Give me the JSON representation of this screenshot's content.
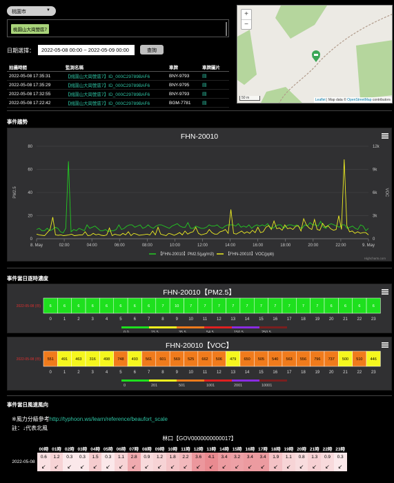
{
  "header": {
    "city": "桃園市",
    "site_tag": "桃園山大崗營區7",
    "date_label": "日期選擇：",
    "date_range": "2022-05-08 00:00 ~ 2022-05-09 00:00",
    "query_button": "查詢"
  },
  "events": {
    "columns": [
      "拍攝時間",
      "監測名稱",
      "車牌",
      "車牌圖片"
    ],
    "rows": [
      {
        "time": "2022-05-08 17:35:31",
        "site": "【桃園山大崗營區7】ID_000C29789BAF6",
        "plate": "BNY-9793"
      },
      {
        "time": "2022-05-08 17:35:29",
        "site": "【桃園山大崗營區7】ID_000C29789BAF6",
        "plate": "BNY-9795"
      },
      {
        "time": "2022-05-08 17:32:55",
        "site": "【桃園山大崗營區7】ID_000C29789BAF6",
        "plate": "BNY-9793"
      },
      {
        "time": "2022-05-08 17:22:42",
        "site": "【桃園山大崗營區7】ID_000C29789BAF6",
        "plate": "BGM-7781"
      }
    ]
  },
  "map": {
    "zoom_in": "+",
    "zoom_out": "−",
    "scale": "50 m",
    "attribution_leaflet": "Leaflet",
    "attribution_text": " | Map data © ",
    "attribution_osm": "OpenStreetMap",
    "attribution_tail": " contributors",
    "colors": {
      "park": "#b5d69d",
      "land": "#eceae4",
      "marker": "#3aa655"
    }
  },
  "trend": {
    "section_title": "事件趨勢",
    "chart_title": "FHN-20010",
    "credit": "Highcharts.com"
  },
  "pm_section": {
    "title": "事件當日逐時濃度"
  },
  "pm_heat": {
    "title": "FHN-20010【PM2.5】",
    "date_label": "2022-05-08 (日)",
    "scale_labels": [
      "0.0",
      "15.5",
      "35.5",
      "54.5",
      "150.5",
      "250.5"
    ],
    "values": [
      "6",
      "6",
      "6",
      "6",
      "6",
      "6",
      "6",
      "6",
      "7",
      "10",
      "7",
      "7",
      "7",
      "7",
      "7",
      "7",
      "7",
      "7",
      "7",
      "7",
      "6",
      "6",
      "6",
      "6"
    ],
    "colors": {
      "cell": "#1ee01e",
      "date": "#d02020"
    }
  },
  "voc_heat": {
    "title": "FHN-20010【VOC】",
    "date_label": "2022-05-08 (日)",
    "scale_labels": [
      "0",
      "201",
      "501",
      "1001",
      "2001",
      "10001"
    ],
    "values": [
      "551",
      "491",
      "463",
      "316",
      "498",
      "748",
      "493",
      "561",
      "601",
      "569",
      "525",
      "662",
      "506",
      "479",
      "650",
      "505",
      "540",
      "563",
      "556",
      "796",
      "737",
      "500",
      "510",
      "446"
    ],
    "cell_colors": [
      "#f07b1c",
      "#f5f71e",
      "#f5f71e",
      "#f5f71e",
      "#f5f71e",
      "#f07b1c",
      "#f5f71e",
      "#f07b1c",
      "#f07b1c",
      "#f07b1c",
      "#f07b1c",
      "#f07b1c",
      "#f07b1c",
      "#f5f71e",
      "#f07b1c",
      "#f07b1c",
      "#f07b1c",
      "#f07b1c",
      "#f07b1c",
      "#f07b1c",
      "#f07b1c",
      "#f5f71e",
      "#f07b1c",
      "#f5f71e"
    ]
  },
  "hours": [
    "0",
    "1",
    "2",
    "3",
    "4",
    "5",
    "6",
    "7",
    "8",
    "9",
    "10",
    "11",
    "12",
    "13",
    "14",
    "15",
    "16",
    "17",
    "18",
    "19",
    "20",
    "21",
    "22",
    "23"
  ],
  "wind": {
    "section_title": "事件當日風速風向",
    "beaufort_prefix": "※風力分級參考",
    "beaufort_link": "http://typhoon.ws/learn/reference/beaufort_scale",
    "note": "註：↓代表北風",
    "table_title": "林口【GOV0000000000017】",
    "hours": [
      "00時",
      "01時",
      "02時",
      "03時",
      "04時",
      "05時",
      "06時",
      "07時",
      "08時",
      "09時",
      "10時",
      "11時",
      "12時",
      "13時",
      "14時",
      "15時",
      "16時",
      "17時",
      "18時",
      "19時",
      "20時",
      "21時",
      "22時",
      "23時"
    ],
    "date": "2022-05-08",
    "speeds": [
      "0.6",
      "1.2",
      "0.3",
      "0.3",
      "1.5",
      "0.3",
      "1.1",
      "2.8",
      "0.9",
      "1.2",
      "1.8",
      "2.2",
      "3.6",
      "4.1",
      "3.4",
      "3.2",
      "3.4",
      "3.4",
      "1.9",
      "1.1",
      "0.8",
      "1.3",
      "0.9",
      "0.3"
    ],
    "arrows": [
      "↙",
      "↙",
      "↙",
      "↙",
      "↙",
      "↙",
      "↙",
      "↙",
      "↙",
      "↙",
      "↙",
      "↙",
      "↙",
      "↙",
      "↙",
      "↙",
      "↙",
      "↙",
      "↙",
      "↙",
      "↙",
      "↙",
      "↙",
      "↙"
    ]
  },
  "chart_data": {
    "type": "line",
    "title": "FHN-20010",
    "x": [
      "8. May",
      "02:00",
      "04:00",
      "06:00",
      "08:00",
      "10:00",
      "12:00",
      "14:00",
      "16:00",
      "18:00",
      "20:00",
      "22:00",
      "9. May"
    ],
    "ylabel": "PM2.5",
    "ylabel_right": "VOC",
    "ylim": [
      0,
      80
    ],
    "ylim_right": [
      0,
      12000
    ],
    "yticks_left": [
      "0",
      "20",
      "40",
      "60",
      "80"
    ],
    "yticks_right": [
      "0",
      "3k",
      "6k",
      "9k",
      "12k"
    ],
    "grid": true,
    "legend_position": "bottom",
    "series": [
      {
        "name": "【FHN-20010】PM2.5(μg/m3)",
        "color": "#22cc22",
        "axis": "left",
        "values": [
          8,
          9,
          7,
          7,
          9,
          7,
          8,
          10,
          9,
          6,
          5,
          9,
          67,
          6,
          8,
          7,
          9,
          8,
          7,
          12,
          9,
          10,
          11,
          9,
          7,
          7,
          8,
          6,
          7,
          7,
          8,
          12,
          8,
          9,
          11,
          12,
          12,
          10,
          11,
          12,
          9,
          10,
          12,
          10,
          9,
          11,
          12,
          12,
          11,
          10,
          9,
          11,
          12,
          13,
          11,
          10,
          10,
          14,
          9,
          9,
          11,
          10,
          9,
          9,
          10,
          12,
          11,
          11,
          12,
          10,
          9,
          11,
          12,
          12,
          12,
          11,
          13,
          10,
          11,
          10,
          12,
          9,
          11,
          12,
          11,
          12,
          11,
          13,
          10,
          9,
          11,
          12,
          12,
          9,
          11,
          12,
          12,
          11,
          12,
          10,
          9,
          12,
          11,
          14,
          12,
          12,
          11,
          15,
          10,
          9,
          12,
          13,
          12,
          11,
          10,
          12,
          12,
          9,
          10,
          11,
          9,
          8,
          12,
          11,
          7,
          9
        ]
      },
      {
        "name": "【FHN-20010】VOC(ppb)",
        "color": "#eeee22",
        "axis": "right",
        "values": [
          600,
          500,
          450,
          400,
          800,
          1200,
          2800,
          500,
          450,
          500,
          400,
          450,
          500,
          600,
          400,
          450,
          500,
          480,
          900,
          400,
          450,
          700,
          500,
          600,
          450,
          400,
          500,
          1400,
          400,
          600,
          500,
          450,
          700,
          500,
          900,
          400,
          700,
          600,
          450,
          500,
          550,
          600,
          480,
          1000,
          500,
          1500,
          600,
          500,
          400,
          700,
          600,
          450,
          600,
          800,
          500,
          1000,
          600,
          800,
          900,
          1500,
          700,
          500,
          600,
          700,
          1200,
          800,
          600,
          600,
          900,
          1000,
          1200,
          700,
          3800,
          700,
          600,
          800,
          1000,
          700,
          900,
          700,
          1100,
          800,
          1500,
          800,
          900,
          1500,
          1700,
          1200,
          2300,
          1300,
          1400,
          1100,
          1800,
          1300,
          1400,
          1200,
          1600,
          1700,
          1000,
          2600,
          1800,
          1400,
          1200,
          2500,
          1200,
          1100,
          2000,
          1500,
          1700,
          1300,
          1100,
          1200,
          3000,
          1200,
          10300,
          1700,
          900,
          1000,
          700,
          900,
          700,
          800,
          800,
          500
        ]
      }
    ]
  }
}
